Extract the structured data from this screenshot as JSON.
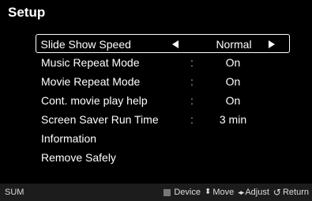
{
  "title": "Setup",
  "menu": {
    "items": [
      {
        "label": "Slide Show Speed",
        "value": "Normal",
        "selected": true
      },
      {
        "label": "Music Repeat Mode",
        "separator": ":",
        "value": "On"
      },
      {
        "label": "Movie Repeat Mode",
        "separator": ":",
        "value": "On"
      },
      {
        "label": "Cont. movie play help",
        "separator": ":",
        "value": "On"
      },
      {
        "label": "Screen Saver Run Time",
        "separator": ":",
        "value": "3 min"
      },
      {
        "label": "Information"
      },
      {
        "label": "Remove Safely"
      }
    ]
  },
  "footer": {
    "source": "SUM",
    "hints": [
      {
        "icon": "square-icon",
        "label": "Device"
      },
      {
        "icon": "updown-arrow-icon",
        "label": "Move"
      },
      {
        "icon": "leftright-arrow-icon",
        "label": "Adjust"
      },
      {
        "icon": "return-icon",
        "label": "Return"
      }
    ]
  }
}
